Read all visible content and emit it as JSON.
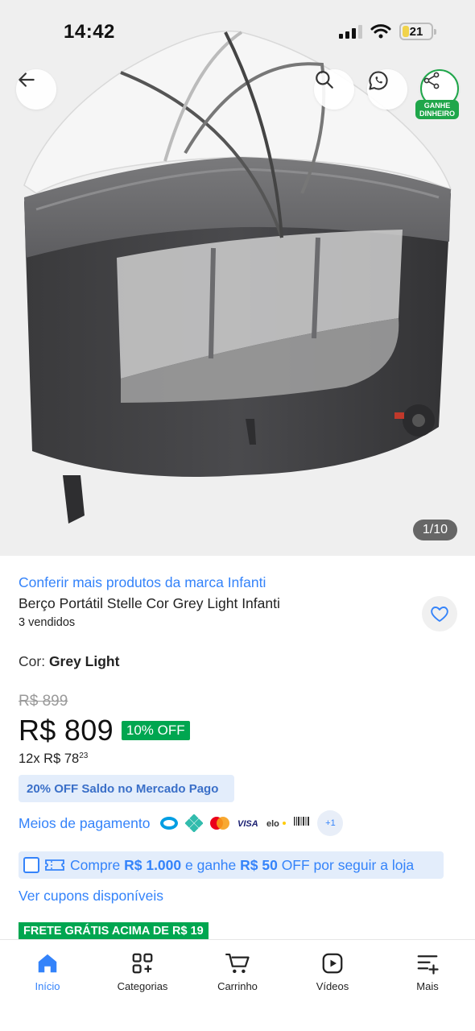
{
  "status_bar": {
    "time": "14:42",
    "battery": "21"
  },
  "header": {
    "share_badge_line1": "GANHE",
    "share_badge_line2": "DINHEIRO"
  },
  "gallery": {
    "counter": "1/10"
  },
  "product": {
    "brand_link": "Conferir mais produtos da marca Infanti",
    "title": "Berço Portátil Stelle Cor Grey Light Infanti",
    "sold": "3 vendidos",
    "color_label": "Cor: ",
    "color_value": "Grey Light",
    "old_price": "R$ 899",
    "price": "R$ 809",
    "discount": "10% OFF",
    "installments_prefix": "12x R$ 78",
    "installments_cents": "23",
    "mp_offer": "20% OFF Saldo no Mercado Pago",
    "payment_methods_label": "Meios de pagamento",
    "payment_more": "+1",
    "coupon": {
      "part1": "Compre ",
      "amount": "R$ 1.000",
      "part2": " e ganhe ",
      "bonus": "R$ 50",
      "part3": " OFF por seguir a loja"
    },
    "see_coupons": "Ver cupons disponíveis",
    "free_shipping": "FRETE GRÁTIS ACIMA DE R$ 19"
  },
  "bottom_nav": [
    {
      "label": "Início",
      "icon": "home-icon",
      "active": true
    },
    {
      "label": "Categorias",
      "icon": "categories-icon"
    },
    {
      "label": "Carrinho",
      "icon": "cart-icon"
    },
    {
      "label": "Vídeos",
      "icon": "video-icon"
    },
    {
      "label": "Mais",
      "icon": "more-icon"
    }
  ],
  "colors": {
    "link": "#3483fa",
    "green": "#00a650",
    "share_green": "#1fa64a",
    "pill_bg": "#e3edfb"
  }
}
